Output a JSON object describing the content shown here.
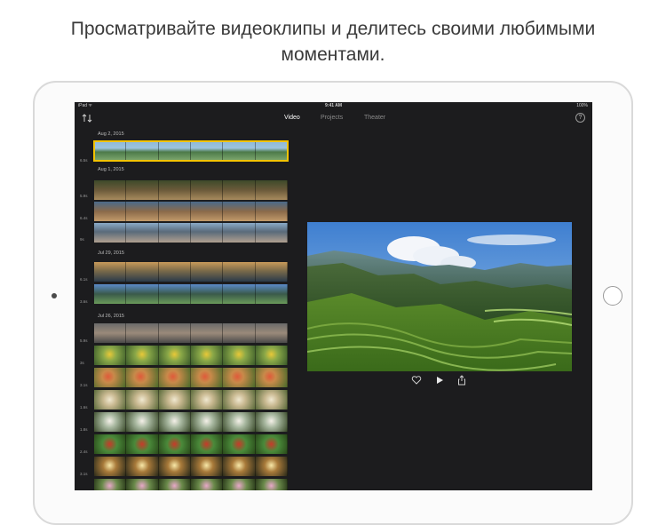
{
  "headline": {
    "line1": "Просматривайте видеоклипы и делитесь своими любимыми",
    "line2": "моментами."
  },
  "status_bar": {
    "carrier": "iPad ᯤ",
    "time": "9:41 AM",
    "battery": "100%"
  },
  "nav": {
    "tabs": [
      {
        "label": "Video",
        "active": true
      },
      {
        "label": "Projects",
        "active": false
      },
      {
        "label": "Theater",
        "active": false
      }
    ],
    "help_label": "?"
  },
  "browser": {
    "groups": [
      {
        "date": "Aug 2, 2015"
      },
      {
        "date": "Aug 1, 2015"
      },
      {
        "date": "Jul 29, 2015"
      },
      {
        "date": "Jul 26, 2015"
      }
    ],
    "durations": [
      "6.5s",
      "5.9s",
      "6.4s",
      "9s",
      "6.1s",
      "3.6s",
      "5.9s",
      "3s",
      "3.1s",
      "1.6s",
      "1.8s",
      "2.4s",
      "3.1s"
    ]
  },
  "colors": {
    "screen_bg": "#1c1c1e",
    "selection": "#f2c300",
    "active_tab": "#ffffff",
    "inactive_tab": "#8a8a8a"
  },
  "icons": {
    "sort": "sort-arrows-icon",
    "help": "help-circle-icon",
    "favorite": "heart-icon",
    "play": "play-icon",
    "share": "share-icon"
  }
}
